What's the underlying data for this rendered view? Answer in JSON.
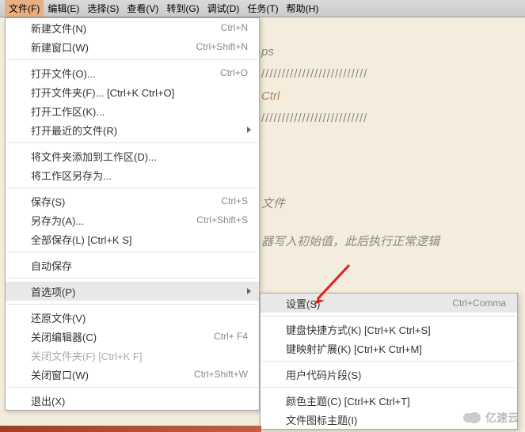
{
  "menubar": {
    "items": [
      {
        "label": "文件(F)"
      },
      {
        "label": "编辑(E)"
      },
      {
        "label": "选择(S)"
      },
      {
        "label": "查看(V)"
      },
      {
        "label": "转到(G)"
      },
      {
        "label": "调试(D)"
      },
      {
        "label": "任务(T)"
      },
      {
        "label": "帮助(H)"
      }
    ]
  },
  "file_menu": {
    "new_file": {
      "label": "新建文件(N)",
      "shortcut": "Ctrl+N"
    },
    "new_window": {
      "label": "新建窗口(W)",
      "shortcut": "Ctrl+Shift+N"
    },
    "open_file": {
      "label": "打开文件(O)...",
      "shortcut": "Ctrl+O"
    },
    "open_folder": {
      "label": "打开文件夹(F)... [Ctrl+K Ctrl+O]",
      "shortcut": ""
    },
    "open_workspace": {
      "label": "打开工作区(K)...",
      "shortcut": ""
    },
    "open_recent": {
      "label": "打开最近的文件(R)",
      "shortcut": ""
    },
    "add_folder": {
      "label": "将文件夹添加到工作区(D)...",
      "shortcut": ""
    },
    "save_workspace_as": {
      "label": "将工作区另存为...",
      "shortcut": ""
    },
    "save": {
      "label": "保存(S)",
      "shortcut": "Ctrl+S"
    },
    "save_as": {
      "label": "另存为(A)...",
      "shortcut": "Ctrl+Shift+S"
    },
    "save_all": {
      "label": "全部保存(L) [Ctrl+K S]",
      "shortcut": ""
    },
    "auto_save": {
      "label": "自动保存",
      "shortcut": ""
    },
    "preferences": {
      "label": "首选项(P)",
      "shortcut": ""
    },
    "revert": {
      "label": "还原文件(V)",
      "shortcut": ""
    },
    "close_editor": {
      "label": "关闭编辑器(C)",
      "shortcut": "Ctrl+  F4"
    },
    "close_folder": {
      "label": "关闭文件夹(F) [Ctrl+K F]",
      "shortcut": ""
    },
    "close_window": {
      "label": "关闭窗口(W)",
      "shortcut": "Ctrl+Shift+W"
    },
    "exit": {
      "label": "退出(X)",
      "shortcut": ""
    }
  },
  "prefs_submenu": {
    "settings": {
      "label": "设置(S)",
      "shortcut": "Ctrl+Comma"
    },
    "shortcuts": {
      "label": "键盘快捷方式(K) [Ctrl+K Ctrl+S]",
      "shortcut": ""
    },
    "keymap_ext": {
      "label": "键映射扩展(K) [Ctrl+K Ctrl+M]",
      "shortcut": ""
    },
    "snippets": {
      "label": "用户代码片段(S)",
      "shortcut": ""
    },
    "color_theme": {
      "label": "颜色主题(C) [Ctrl+K Ctrl+T]",
      "shortcut": ""
    },
    "icon_theme": {
      "label": "文件图标主题(I)",
      "shortcut": ""
    }
  },
  "code_bg": {
    "l1": "ps",
    "l2": "//////////////////////////",
    "l3": "Ctrl",
    "l4": "//////////////////////////",
    "l5": "文件",
    "l6": "器写入初始值，此后执行正常逻辑"
  },
  "watermark": {
    "text": "亿速云"
  }
}
